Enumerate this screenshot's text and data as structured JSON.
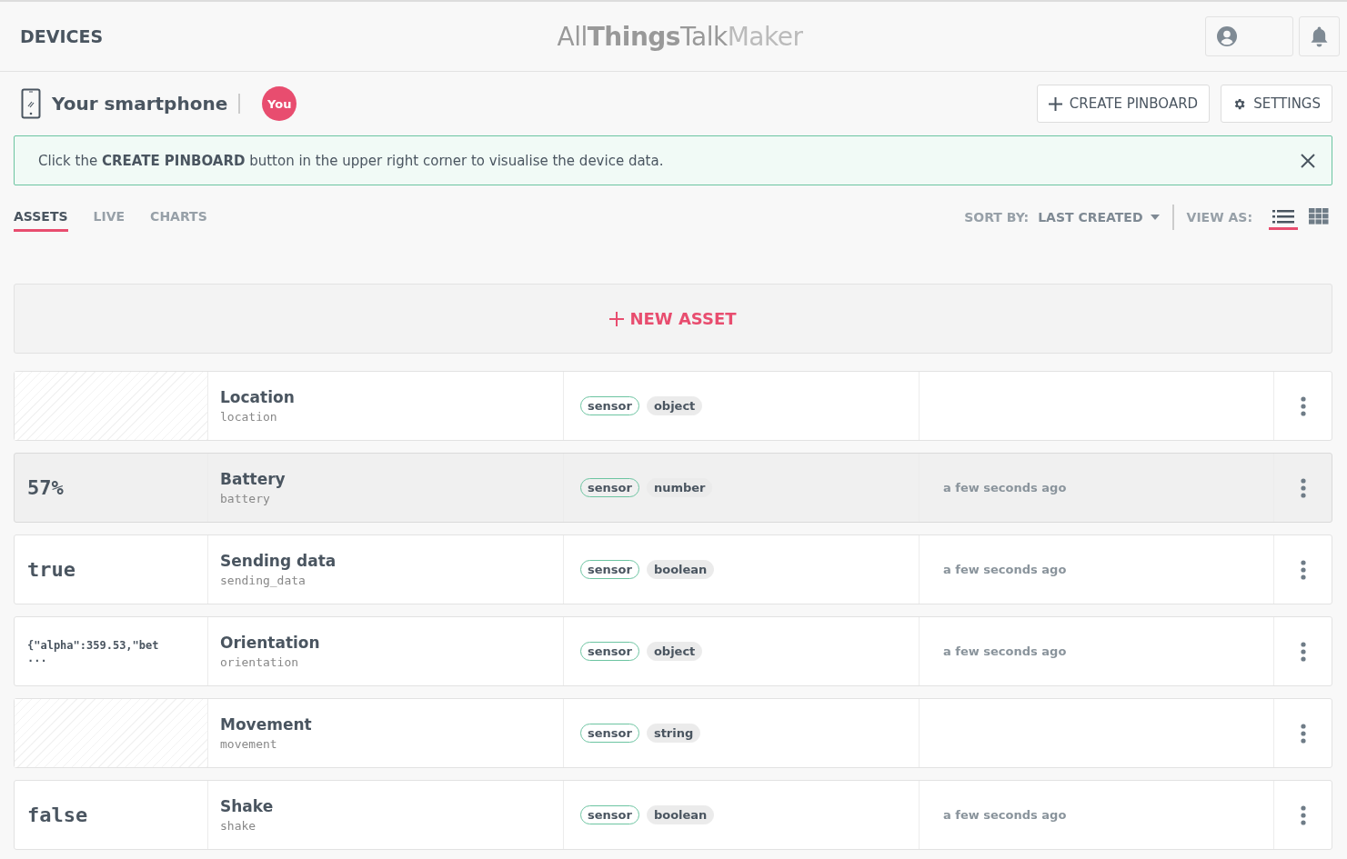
{
  "header": {
    "title": "DEVICES",
    "logo": {
      "part_1": "All",
      "part_2": "Things",
      "part_3": "Talk",
      "part_4": "Maker"
    }
  },
  "device": {
    "name": "Your smartphone",
    "badge": "You",
    "buttons": [
      {
        "kind": "create",
        "label": "CREATE PINBOARD"
      },
      {
        "kind": "settings",
        "label": "SETTINGS"
      }
    ]
  },
  "notice": {
    "text": "Click the **CREATE PINBOARD** button in the upper right corner to visualise the device data."
  },
  "tabs": [
    {
      "label": "ASSETS",
      "selected": true
    },
    {
      "label": "LIVE",
      "selected": false
    },
    {
      "label": "CHARTS",
      "selected": false
    }
  ],
  "sort": {
    "label": "SORT BY:",
    "value": "LAST CREATED"
  },
  "view": {
    "label": "VIEW AS:",
    "options": [
      {
        "kind": "list",
        "selected": true
      },
      {
        "kind": "grid",
        "selected": false
      }
    ]
  },
  "new_asset": {
    "label": "NEW ASSET"
  },
  "assets": [
    {
      "kind": "empty",
      "name": "Location",
      "id": "location",
      "tags": [
        "sensor",
        "object"
      ],
      "highlighted": false
    },
    {
      "kind": "large",
      "value": "57%",
      "name": "Battery",
      "id": "battery",
      "tags": [
        "sensor",
        "number"
      ],
      "time": "a few seconds ago",
      "highlighted": true
    },
    {
      "kind": "large",
      "value": "true",
      "name": "Sending data",
      "id": "sending_data",
      "tags": [
        "sensor",
        "boolean"
      ],
      "time": "a few seconds ago",
      "highlighted": false
    },
    {
      "kind": "json",
      "value": "{\"alpha\":359.53,\"bet",
      "more": "...",
      "name": "Orientation",
      "id": "orientation",
      "tags": [
        "sensor",
        "object"
      ],
      "time": "a few seconds ago",
      "highlighted": false
    },
    {
      "kind": "empty",
      "name": "Movement",
      "id": "movement",
      "tags": [
        "sensor",
        "string"
      ],
      "highlighted": false
    },
    {
      "kind": "large",
      "value": "false",
      "name": "Shake",
      "id": "shake",
      "tags": [
        "sensor",
        "boolean"
      ],
      "time": "a few seconds ago",
      "highlighted": false
    }
  ]
}
